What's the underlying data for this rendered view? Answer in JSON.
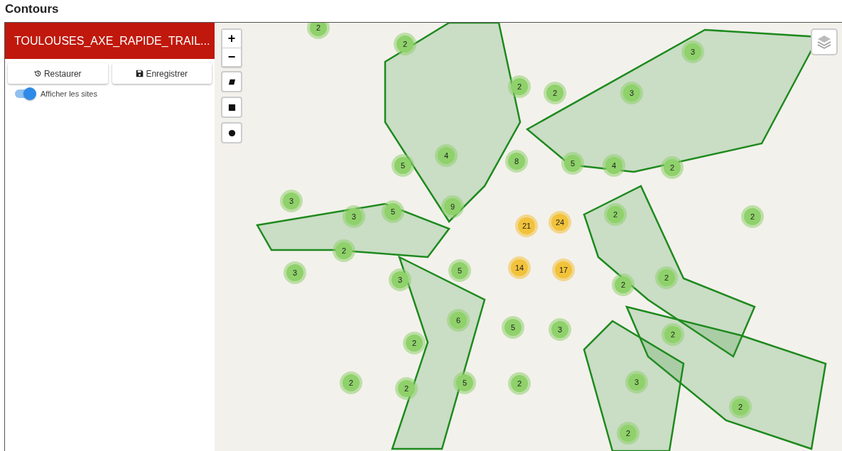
{
  "page_title": "Contours",
  "panel": {
    "title": "TOULOUSES_AXE_RAPIDE_TRAIL...",
    "buttons": [
      {
        "label": "Restaurer",
        "kind": "restore"
      },
      {
        "label": "Enregistrer",
        "kind": "save"
      }
    ],
    "toggle": {
      "label": "Afficher les sites",
      "on": true
    }
  },
  "map": {
    "zoom_controls": [
      "+",
      "−"
    ],
    "draw_tools": [
      {
        "kind": "parallelogram"
      },
      {
        "kind": "square"
      },
      {
        "kind": "circle"
      }
    ],
    "clusters": [
      {
        "count": "2",
        "color": "#8fd16a"
      },
      {
        "count": "2",
        "color": "#8fd16a"
      },
      {
        "count": "3",
        "color": "#8fd16a"
      },
      {
        "count": "2",
        "color": "#8fd16a"
      },
      {
        "count": "2",
        "color": "#8fd16a"
      },
      {
        "count": "3",
        "color": "#8fd16a"
      },
      {
        "count": "4",
        "color": "#8fd16a"
      },
      {
        "count": "5",
        "color": "#8fd16a"
      },
      {
        "count": "8",
        "color": "#8fd16a"
      },
      {
        "count": "5",
        "color": "#8fd16a"
      },
      {
        "count": "4",
        "color": "#8fd16a"
      },
      {
        "count": "2",
        "color": "#8fd16a"
      },
      {
        "count": "3",
        "color": "#8fd16a"
      },
      {
        "count": "9",
        "color": "#8fd16a"
      },
      {
        "count": "5",
        "color": "#8fd16a"
      },
      {
        "count": "3",
        "color": "#8fd16a"
      },
      {
        "count": "21",
        "color": "#f2c23a"
      },
      {
        "count": "24",
        "color": "#f2c23a"
      },
      {
        "count": "2",
        "color": "#8fd16a"
      },
      {
        "count": "2",
        "color": "#8fd16a"
      },
      {
        "count": "2",
        "color": "#8fd16a"
      },
      {
        "count": "14",
        "color": "#f2c23a"
      },
      {
        "count": "17",
        "color": "#f2c23a"
      },
      {
        "count": "3",
        "color": "#8fd16a"
      },
      {
        "count": "5",
        "color": "#8fd16a"
      },
      {
        "count": "3",
        "color": "#8fd16a"
      },
      {
        "count": "2",
        "color": "#8fd16a"
      },
      {
        "count": "2",
        "color": "#8fd16a"
      },
      {
        "count": "6",
        "color": "#8fd16a"
      },
      {
        "count": "5",
        "color": "#8fd16a"
      },
      {
        "count": "3",
        "color": "#8fd16a"
      },
      {
        "count": "2",
        "color": "#8fd16a"
      },
      {
        "count": "2",
        "color": "#8fd16a"
      },
      {
        "count": "2",
        "color": "#8fd16a"
      },
      {
        "count": "2",
        "color": "#8fd16a"
      },
      {
        "count": "5",
        "color": "#8fd16a"
      },
      {
        "count": "2",
        "color": "#8fd16a"
      },
      {
        "count": "3",
        "color": "#8fd16a"
      },
      {
        "count": "2",
        "color": "#8fd16a"
      },
      {
        "count": "2",
        "color": "#8fd16a"
      }
    ]
  }
}
